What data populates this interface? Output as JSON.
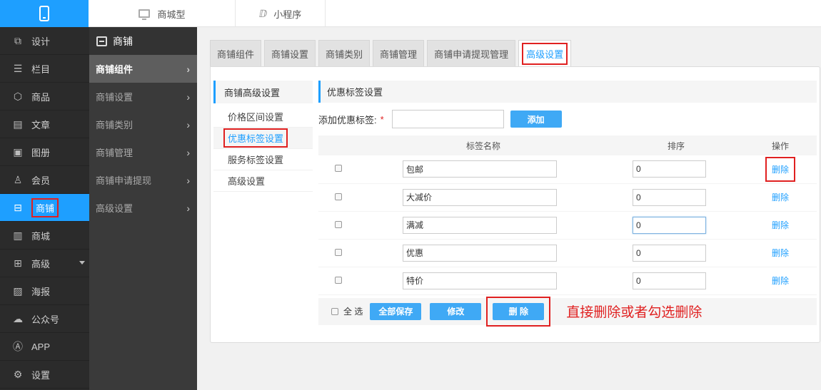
{
  "topbar": {
    "tabs": [
      {
        "label": "商城型",
        "icon": "monitor-icon"
      },
      {
        "label": "小程序",
        "icon": "mini-program-icon"
      }
    ]
  },
  "sidebar": {
    "items": [
      {
        "label": "设计",
        "icon": "design-icon"
      },
      {
        "label": "栏目",
        "icon": "list-icon"
      },
      {
        "label": "商品",
        "icon": "box-icon"
      },
      {
        "label": "文章",
        "icon": "article-icon"
      },
      {
        "label": "图册",
        "icon": "image-icon"
      },
      {
        "label": "会员",
        "icon": "user-icon"
      },
      {
        "label": "商铺",
        "icon": "store-icon",
        "active": true
      },
      {
        "label": "商城",
        "icon": "clipboard-icon"
      },
      {
        "label": "高级",
        "icon": "grid-icon",
        "dropdown": true
      },
      {
        "label": "海报",
        "icon": "poster-icon"
      },
      {
        "label": "公众号",
        "icon": "wechat-icon"
      },
      {
        "label": "APP",
        "icon": "app-icon"
      },
      {
        "label": "设置",
        "icon": "gear-icon"
      }
    ]
  },
  "subside": {
    "title": "商铺",
    "items": [
      {
        "label": "商铺组件",
        "active": true
      },
      {
        "label": "商铺设置"
      },
      {
        "label": "商铺类别"
      },
      {
        "label": "商铺管理"
      },
      {
        "label": "商铺申请提现"
      },
      {
        "label": "高级设置"
      }
    ]
  },
  "tabs": [
    {
      "label": "商铺组件"
    },
    {
      "label": "商铺设置"
    },
    {
      "label": "商铺类别"
    },
    {
      "label": "商铺管理"
    },
    {
      "label": "商铺申请提现管理"
    },
    {
      "label": "高级设置",
      "active": true
    }
  ],
  "innernav": {
    "title": "商铺高级设置",
    "items": [
      {
        "label": "价格区间设置"
      },
      {
        "label": "优惠标签设置",
        "active": true
      },
      {
        "label": "服务标签设置"
      },
      {
        "label": "高级设置"
      }
    ]
  },
  "content": {
    "section_title": "优惠标签设置",
    "add_label": "添加优惠标签:",
    "required_mark": "*",
    "add_button": "添加",
    "columns": [
      "标签名称",
      "排序",
      "操作"
    ],
    "rows": [
      {
        "name": "包邮",
        "sort": "0",
        "action": "删除"
      },
      {
        "name": "大减价",
        "sort": "0",
        "action": "删除"
      },
      {
        "name": "满减",
        "sort": "0",
        "action": "删除"
      },
      {
        "name": "优惠",
        "sort": "0",
        "action": "删除"
      },
      {
        "name": "特价",
        "sort": "0",
        "action": "删除"
      }
    ],
    "select_all": "全 选",
    "save_all": "全部保存",
    "edit": "修改",
    "delete": "删 除",
    "annotation": "直接删除或者勾选删除"
  },
  "colors": {
    "accent": "#1e9fff",
    "highlight": "#e02020",
    "sidebar": "#2b2b2b"
  }
}
